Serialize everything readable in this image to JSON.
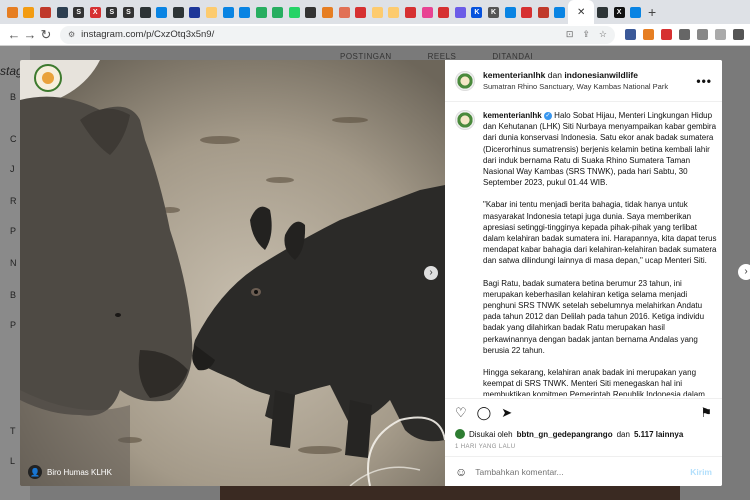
{
  "browser": {
    "tabs": [
      {
        "icon": "tab-favicon",
        "color": "#e67e22",
        "letter": ""
      },
      {
        "icon": "tab-favicon",
        "color": "#f39c12",
        "letter": ""
      },
      {
        "icon": "tab-favicon",
        "color": "#c0392b",
        "letter": ""
      },
      {
        "icon": "tab-favicon",
        "color": "#2c3e50",
        "letter": ""
      },
      {
        "icon": "tab-favicon",
        "color": "#333333",
        "letter": "S"
      },
      {
        "icon": "tab-favicon",
        "color": "#d63031",
        "letter": "X"
      },
      {
        "icon": "tab-favicon",
        "color": "#333333",
        "letter": "S"
      },
      {
        "icon": "tab-favicon",
        "color": "#333333",
        "letter": "S"
      },
      {
        "icon": "tab-favicon",
        "color": "#2d3436",
        "letter": ""
      },
      {
        "icon": "tab-favicon",
        "color": "#0984e3",
        "letter": ""
      },
      {
        "icon": "tab-favicon",
        "color": "#2d3436",
        "letter": ""
      },
      {
        "icon": "tab-favicon",
        "color": "#1e3799",
        "letter": ""
      },
      {
        "icon": "tab-favicon",
        "color": "#fdcb6e",
        "letter": ""
      },
      {
        "icon": "tab-favicon",
        "color": "#0984e3",
        "letter": ""
      },
      {
        "icon": "tab-favicon",
        "color": "#0984e3",
        "letter": ""
      },
      {
        "icon": "tab-favicon",
        "color": "#27ae60",
        "letter": ""
      },
      {
        "icon": "tab-favicon",
        "color": "#27ae60",
        "letter": ""
      },
      {
        "icon": "tab-favicon",
        "color": "#25d366",
        "letter": ""
      },
      {
        "icon": "tab-favicon",
        "color": "#333333",
        "letter": ""
      },
      {
        "icon": "tab-favicon",
        "color": "#e67e22",
        "letter": ""
      },
      {
        "icon": "tab-favicon",
        "color": "#e17055",
        "letter": ""
      },
      {
        "icon": "tab-favicon",
        "color": "#d63031",
        "letter": ""
      },
      {
        "icon": "tab-favicon",
        "color": "#fdcb6e",
        "letter": ""
      },
      {
        "icon": "tab-favicon",
        "color": "#fdcb6e",
        "letter": ""
      },
      {
        "icon": "tab-favicon",
        "color": "#d63031",
        "letter": ""
      },
      {
        "icon": "tab-favicon",
        "color": "#e84393",
        "letter": ""
      },
      {
        "icon": "tab-favicon",
        "color": "#d63031",
        "letter": ""
      },
      {
        "icon": "tab-favicon",
        "color": "#6c5ce7",
        "letter": ""
      },
      {
        "icon": "tab-favicon",
        "color": "#0652dd",
        "letter": "K"
      },
      {
        "icon": "tab-favicon",
        "color": "#555555",
        "letter": "K"
      },
      {
        "icon": "tab-favicon",
        "color": "#0984e3",
        "letter": ""
      },
      {
        "icon": "tab-favicon",
        "color": "#d63031",
        "letter": ""
      },
      {
        "icon": "tab-favicon",
        "color": "#c0392b",
        "letter": ""
      },
      {
        "icon": "tab-favicon",
        "color": "#0984e3",
        "letter": ""
      }
    ],
    "active_tab_close": "✕",
    "after_tabs": [
      {
        "color": "#2d3436",
        "letter": ""
      },
      {
        "color": "#111111",
        "letter": "X"
      },
      {
        "color": "#0984e3",
        "letter": ""
      }
    ],
    "new_tab": "+",
    "url": "instagram.com/p/CxzOtq3x5n9/",
    "nav": {
      "back": "←",
      "forward": "→",
      "reload": "↻"
    }
  },
  "page_behind": {
    "brand": "stag",
    "subtabs": [
      "POSTINGAN",
      "REELS",
      "DITANDAI"
    ],
    "left_nav_letters": [
      "B",
      "C",
      "J",
      "R",
      "P",
      "N",
      "B",
      "P",
      "T",
      "L"
    ]
  },
  "post": {
    "photo_credit": "Biro Humas KLHK",
    "header_user": "kementerianlhk",
    "header_connector": "dan",
    "header_collab": "indonesianwildlife",
    "location": "Sumatran Rhino Sanctuary, Way Kambas National Park",
    "more": "•••",
    "caption_user": "kementerianlhk",
    "caption_p1": "Halo Sobat Hijau, Menteri Lingkungan Hidup dan Kehutanan (LHK) Siti Nurbaya menyampaikan kabar gembira dari dunia konservasi Indonesia. Satu ekor anak badak sumatera (Dicerorhinus sumatrensis) berjenis kelamin betina kembali lahir dari induk bernama Ratu di Suaka Rhino Sumatera Taman Nasional Way Kambas (SRS TNWK), pada hari Sabtu, 30 September 2023, pukul 01.44 WIB.",
    "caption_p2": "\"Kabar ini tentu menjadi berita bahagia, tidak hanya untuk masyarakat Indonesia tetapi juga dunia. Saya memberikan apresiasi setinggi-tingginya kepada pihak-pihak yang terlibat dalam kelahiran badak sumatera ini. Harapannya, kita dapat terus mendapat kabar bahagia dari kelahiran-kelahiran badak sumatera dan satwa dilindungi lainnya di masa depan,\" ucap Menteri Siti.",
    "caption_p3": "Bagi Ratu, badak sumatera betina berumur 23 tahun, ini merupakan keberhasilan kelahiran ketiga selama menjadi penghuni SRS TNWK setelah sebelumnya melahirkan Andatu pada tahun 2012 dan Delilah pada tahun 2016. Ketiga individu badak yang dilahirkan badak Ratu merupakan hasil perkawinannya dengan badak jantan bernama Andalas yang berusia 22 tahun.",
    "caption_p4": "Hingga sekarang, kelahiran anak badak ini merupakan yang keempat di SRS TNWK. Menteri Siti menegaskan hal ini membuktikan komitmen Pemerintah Republik Indonesia dalam melakukan upaya konservasi badak di Indonesia, khususnya badak sumatera.",
    "liked_prefix": "Disukai oleh",
    "liked_user": "bbtn_gn_gedepangrango",
    "liked_connector": "dan",
    "liked_others": "5.117 lainnya",
    "time_ago": "1 HARI YANG LALU",
    "comment_placeholder": "Tambahkan komentar...",
    "post_button": "Kirim"
  }
}
